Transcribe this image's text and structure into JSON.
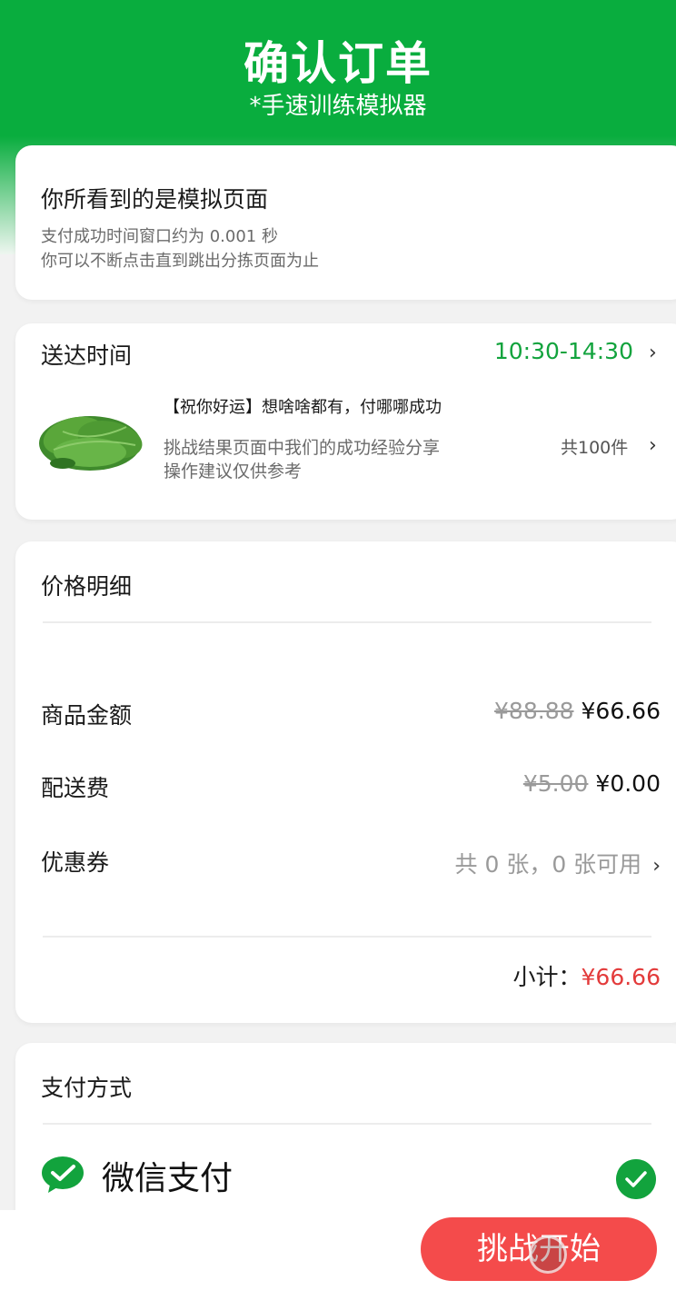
{
  "header": {
    "title": "确认订单",
    "subtitle": "*手速训练模拟器"
  },
  "notice": {
    "heading": "你所看到的是模拟页面",
    "line1": "支付成功时间窗口约为 0.001 秒",
    "line2": "你可以不断点击直到跳出分拣页面为止"
  },
  "delivery": {
    "label": "送达时间",
    "time": "10:30-14:30",
    "product_title": "【祝你好运】想啥啥都有，付哪哪成功",
    "product_desc1": "挑战结果页面中我们的成功经验分享",
    "product_desc2": "操作建议仅供参考",
    "count": "共100件",
    "image_icon": "spinach-image",
    "time_color": "#12a33d"
  },
  "price": {
    "title": "价格明细",
    "goods_label": "商品金额",
    "goods_original": "¥88.88",
    "goods_price": "¥66.66",
    "delivery_label": "配送费",
    "delivery_original": "¥5.00",
    "delivery_price": "¥0.00",
    "coupon_label": "优惠券",
    "coupon_value": "共 0 张，0 张可用",
    "subtotal_label": "小计：",
    "subtotal_value": "¥66.66",
    "subtotal_color": "#e33b3b"
  },
  "payment": {
    "title": "支付方式",
    "method_label": "微信支付",
    "method_icon": "wechat-pay-icon",
    "selected_icon": "check-circle-icon"
  },
  "action": {
    "start_label": "挑战开始",
    "button_color": "#f44b4b"
  },
  "colors": {
    "brand_green": "#09ad3e"
  }
}
